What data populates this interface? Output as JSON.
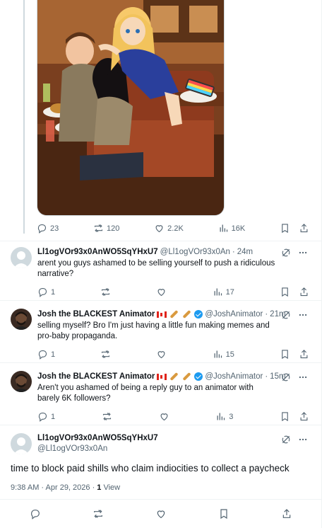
{
  "post_actions": {
    "reply_count": "23",
    "repost_count": "120",
    "like_count": "2.2K",
    "view_count": "16K"
  },
  "replies": [
    {
      "display_name": "Ll1ogVOr93x0AnWO5SqYHxU7",
      "handle": "@Ll1ogVOr93x0An",
      "time": "24m",
      "text": "arent you guys ashamed to be selling yourself to push a ridiculous narrative?",
      "reply_count": "1",
      "view_count": "17"
    },
    {
      "display_name": "Josh the BLACKEST Animator",
      "handle": "@JoshAnimator",
      "time": "21m",
      "text": "selling myself? Bro I'm just having a little fun making memes and pro-baby propaganda.",
      "reply_count": "1",
      "view_count": "15"
    },
    {
      "display_name": "Josh the BLACKEST Animator",
      "handle": "@JoshAnimator",
      "time": "15m",
      "text": "Aren't you ashamed of being a reply guy to an animator with barely 6K followers?",
      "reply_count": "1",
      "view_count": "3"
    }
  ],
  "main_post": {
    "display_name": "Ll1ogVOr93x0AnWO5SqYHxU7",
    "handle": "@Ll1ogVOr93x0An",
    "text": "time to block paid shills who claim indiocities to collect a paycheck",
    "timestamp": "9:38 AM · Apr 29, 2026 · ",
    "views_number": "1",
    "views_label": " View"
  },
  "colors": {
    "accent": "#1d9bf0",
    "muted_text": "#536471",
    "border": "#eff3f4"
  },
  "icons": [
    "reply-icon",
    "repost-icon",
    "like-icon",
    "views-icon",
    "bookmark-icon",
    "share-icon",
    "grok-icon",
    "more-icon"
  ]
}
